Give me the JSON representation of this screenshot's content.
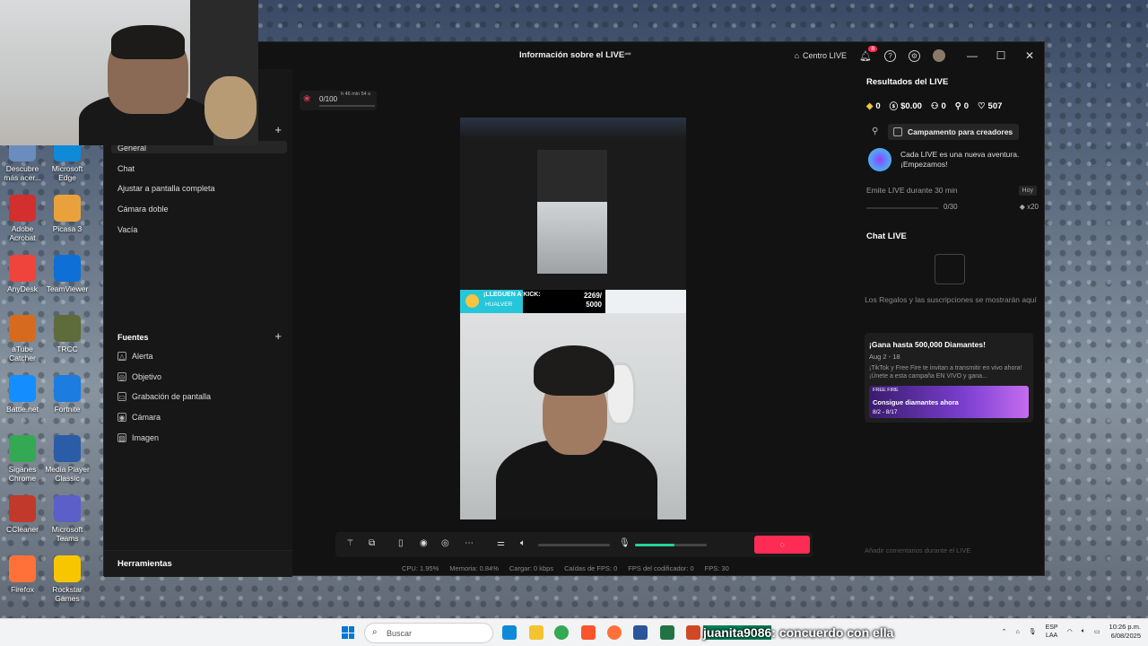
{
  "window": {
    "title": "Información sobre el LIVE",
    "centro_live": "Centro LIVE",
    "notif_count": "8"
  },
  "scenes": {
    "items": [
      "General",
      "Chat",
      "Ajustar a pantalla completa",
      "Cámara doble",
      "Vacía"
    ]
  },
  "sources": {
    "title": "Fuentes",
    "items": [
      {
        "label": "Alerta",
        "icon": "bell-icon"
      },
      {
        "label": "Objetivo",
        "icon": "shield-icon"
      },
      {
        "label": "Grabación de pantalla",
        "icon": "screen-icon"
      },
      {
        "label": "Cámara",
        "icon": "camera-icon"
      },
      {
        "label": "Imagen",
        "icon": "image-icon"
      }
    ]
  },
  "tools": {
    "title": "Herramientas"
  },
  "goal_widget": {
    "value": "0/100",
    "time": "h 46 min 54 s"
  },
  "preview": {
    "goal_label": "¡LLEGUEN A KICK:",
    "goal_sub": "HUALVER",
    "goal_num": "2269/",
    "goal_total": "5000"
  },
  "controls": {
    "volume_level": 0.0,
    "mic_level": 0.55
  },
  "stats": {
    "cpu": "CPU: 1.95%",
    "memoria": "Memoria: 0.84%",
    "cargar": "Cargar: 0 kbps",
    "caidas": "Caídas de FPS: 0",
    "codificador": "FPS del codificador: 0",
    "fps": "FPS: 30"
  },
  "results": {
    "title": "Resultados del LIVE",
    "diamonds": "0",
    "money": "$0.00",
    "viewers": "0",
    "followers": "0",
    "likes": "507"
  },
  "campamento": {
    "label": "Campamento para creadores"
  },
  "adventure": {
    "text": "Cada LIVE es una nueva aventura. ¡Empezamos!"
  },
  "task": {
    "label": "Emite LIVE durante 30 min",
    "tag": "Hoy",
    "value": "0/30",
    "reward": "x20"
  },
  "chat": {
    "title": "Chat LIVE",
    "empty": "Los Regalos y las suscripciones se mostrarán aquí",
    "input_placeholder": "Añadir comentarios durante el LIVE"
  },
  "promo": {
    "title": "¡Gana hasta 500,000 Diamantes!",
    "dates": "Aug 2 - 18",
    "body": "¡TikTok y Free Fire te invitan a transmitir en vivo ahora! ¡Únete a esta campaña EN VIVO y gana...",
    "banner_brand": "FREE FIRE",
    "banner_title": "Consigue diamantes ahora",
    "banner_dates": "8/2 - 8/17"
  },
  "desktop_icons": [
    {
      "label": "Descubre más acer...",
      "color": "#6a8cbf"
    },
    {
      "label": "Microsoft Edge",
      "color": "#0f8ad8"
    },
    {
      "label": "Adobe Acrobat",
      "color": "#d32f2f"
    },
    {
      "label": "Picasa 3",
      "color": "#e9a23b"
    },
    {
      "label": "AnyDesk",
      "color": "#ef443b"
    },
    {
      "label": "TeamViewer",
      "color": "#0e6fd6"
    },
    {
      "label": "aTube Catcher",
      "color": "#d66a1e"
    },
    {
      "label": "TRCC",
      "color": "#5e6b3a"
    },
    {
      "label": "Battle.net",
      "color": "#148eff"
    },
    {
      "label": "Fortnite",
      "color": "#1c7ce0"
    },
    {
      "label": "Siganes Chrome",
      "color": "#34a853"
    },
    {
      "label": "Media Player Classic",
      "color": "#2b5ca8"
    },
    {
      "label": "CCleaner",
      "color": "#c0392b"
    },
    {
      "label": "Microsoft Teams",
      "color": "#5b5fc7"
    },
    {
      "label": "Firefox",
      "color": "#ff7139"
    },
    {
      "label": "Rockstar Games",
      "color": "#f7c600"
    }
  ],
  "taskbar": {
    "search_placeholder": "Buscar",
    "overlay_user": "juanita9086",
    "overlay_msg": ": concuerdo con ella",
    "lang": "ESP",
    "lang2": "LAA",
    "time": "10:26 p.m.",
    "date": "6/08/2025"
  }
}
